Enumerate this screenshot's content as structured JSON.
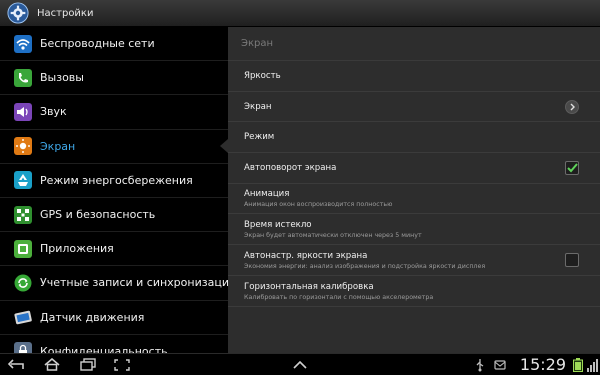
{
  "titlebar": {
    "title": "Настройки",
    "icon": "gear-icon"
  },
  "sidebar": {
    "items": [
      {
        "label": "Беспроводные сети",
        "icon": "wifi-icon",
        "active": false
      },
      {
        "label": "Вызовы",
        "icon": "phone-icon",
        "active": false
      },
      {
        "label": "Звук",
        "icon": "speaker-icon",
        "active": false
      },
      {
        "label": "Экран",
        "icon": "display-icon",
        "active": true
      },
      {
        "label": "Режим энергосбережения",
        "icon": "recycle-icon",
        "active": false
      },
      {
        "label": "GPS и безопасность",
        "icon": "gps-icon",
        "active": false
      },
      {
        "label": "Приложения",
        "icon": "apps-icon",
        "active": false
      },
      {
        "label": "Учетные записи и синхронизация",
        "icon": "sync-icon",
        "active": false
      },
      {
        "label": "Датчик движения",
        "icon": "tablet-icon",
        "active": false
      },
      {
        "label": "Конфиденциальность",
        "icon": "privacy-icon",
        "active": false
      }
    ]
  },
  "main": {
    "header": "Экран",
    "rows": [
      {
        "title": "Яркость",
        "subtitle": ""
      },
      {
        "title": "Экран",
        "subtitle": "",
        "control": "chevron"
      },
      {
        "title": "Режим",
        "subtitle": ""
      },
      {
        "title": "Автоповорот экрана",
        "subtitle": "",
        "control": "checkbox",
        "checked": true
      },
      {
        "title": "Анимация",
        "subtitle": "Анимация окон воспроизводится полностью"
      },
      {
        "title": "Время истекло",
        "subtitle": "Экран будет автоматически отключен через 5 минут"
      },
      {
        "title": "Автонастр. яркости экрана",
        "subtitle": "Экономия энергии: анализ изображения и подстройка яркости дисплея",
        "control": "checkbox",
        "checked": false
      },
      {
        "title": "Горизонтальная калибровка",
        "subtitle": "Калибровать по горизонтали с помощью акселерометра"
      }
    ]
  },
  "systembar": {
    "time": "15:29"
  },
  "colors": {
    "accent": "#3fa8e8",
    "check": "#5fd35a",
    "panel": "#2d2d2d"
  }
}
